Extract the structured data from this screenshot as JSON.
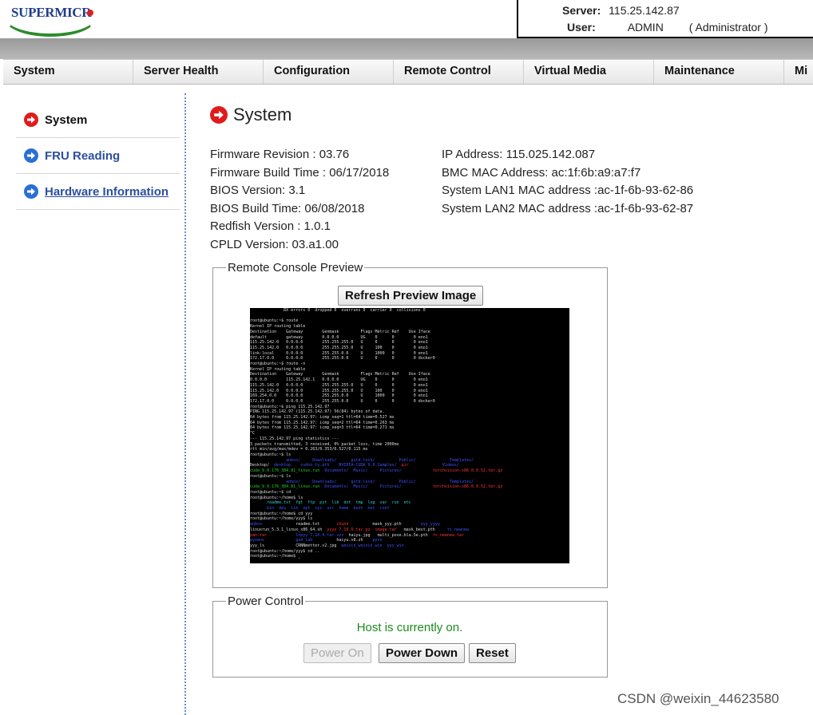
{
  "header": {
    "logo_text": "SUPERMICR",
    "server_label": "Server:",
    "server_value": "115.25.142.87",
    "user_label": "User:",
    "user_value": "ADMIN",
    "user_role": "( Administrator )"
  },
  "nav": {
    "items": [
      "System",
      "Server Health",
      "Configuration",
      "Remote Control",
      "Virtual Media",
      "Maintenance",
      "Mis"
    ]
  },
  "sidebar": {
    "items": [
      {
        "label": "System",
        "icon": "arrow-right-icon",
        "color": "#e01b1b"
      },
      {
        "label": "FRU Reading",
        "icon": "arrow-right-icon",
        "color": "#2a6fd4"
      },
      {
        "label": "Hardware Information",
        "icon": "arrow-right-icon",
        "color": "#2a6fd4"
      }
    ]
  },
  "page": {
    "title": "System"
  },
  "info_left": [
    "Firmware Revision :  03.76",
    "Firmware Build Time :  06/17/2018",
    "BIOS Version: 3.1",
    "BIOS Build Time: 06/08/2018",
    "Redfish Version : 1.0.1",
    "CPLD Version: 03.a1.00"
  ],
  "info_right": [
    "IP Address:  115.025.142.087",
    "BMC MAC Address:  ac:1f:6b:a9:a7:f7",
    "System LAN1 MAC address :ac-1f-6b-93-62-86",
    "System LAN2 MAC address :ac-1f-6b-93-62-87"
  ],
  "preview": {
    "legend": "Remote Console Preview",
    "refresh_label": "Refresh Preview Image"
  },
  "power": {
    "legend": "Power Control",
    "status": "Host is currently on.",
    "power_on_label": "Power On",
    "power_down_label": "Power Down",
    "reset_label": "Reset"
  },
  "watermark": "CSDN @weixin_44623580",
  "colors": {
    "accent_red": "#e01b1b",
    "accent_blue": "#2a6fd4",
    "status_green": "#1c8a1c"
  }
}
